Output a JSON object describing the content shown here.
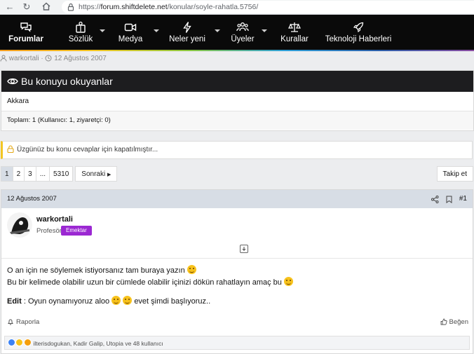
{
  "browser": {
    "url_prefix": "https://",
    "url_host": "forum.shiftdelete.net",
    "url_path": "/konular/soyle-rahatla.5756/"
  },
  "nav": {
    "items": [
      {
        "label": "Forumlar",
        "icon": "chat-bubbles-icon"
      },
      {
        "label": "Sözlük",
        "icon": "book-person-icon"
      },
      {
        "label": "Medya",
        "icon": "video-camera-icon"
      },
      {
        "label": "Neler yeni",
        "icon": "lightning-icon"
      },
      {
        "label": "Üyeler",
        "icon": "users-icon"
      },
      {
        "label": "Kurallar",
        "icon": "scales-icon"
      },
      {
        "label": "Teknoloji Haberleri",
        "icon": "rocket-icon"
      }
    ]
  },
  "thread_meta": {
    "author": "warkortali",
    "date": "12 Ağustos 2007"
  },
  "readers": {
    "title": "Bu konuyu okuyanlar",
    "names": "Akkara",
    "total": "Toplam: 1 (Kullanıcı: 1, ziyaretçi: 0)"
  },
  "notice": "Üzgünüz bu konu cevaplar için kapatılmıştır...",
  "pager": {
    "pages": [
      "1",
      "2",
      "3",
      "...",
      "5310"
    ],
    "next_label": "Sonraki",
    "follow_label": "Takip et"
  },
  "post": {
    "date": "12 Ağustos 2007",
    "number": "#1",
    "username": "warkortali",
    "user_title": "Profesör",
    "badge": "Emektar",
    "line1": "O an için ne söylemek istiyorsanız tam buraya yazın",
    "line2": "Bu bir kelimede olabilir uzun bir cümlede olabilir içinizi dökün rahatlayın amaç bu",
    "edit_label": "Edit",
    "line3a": " : Oyun oynamıyoruz aloo",
    "line3b": "evet şimdi başlıyoruz..",
    "report_label": "Raporla",
    "like_label": "Beğen",
    "reactions_text": "ilterisdogukan, Kadir Galip, Utopia ve 48 kullanıcı"
  },
  "colors": {
    "nav_bg": "#0a0a0a",
    "post_header_bg": "#d7dde5",
    "badge_bg": "#9b28d2",
    "notice_accent": "#f3c622"
  }
}
